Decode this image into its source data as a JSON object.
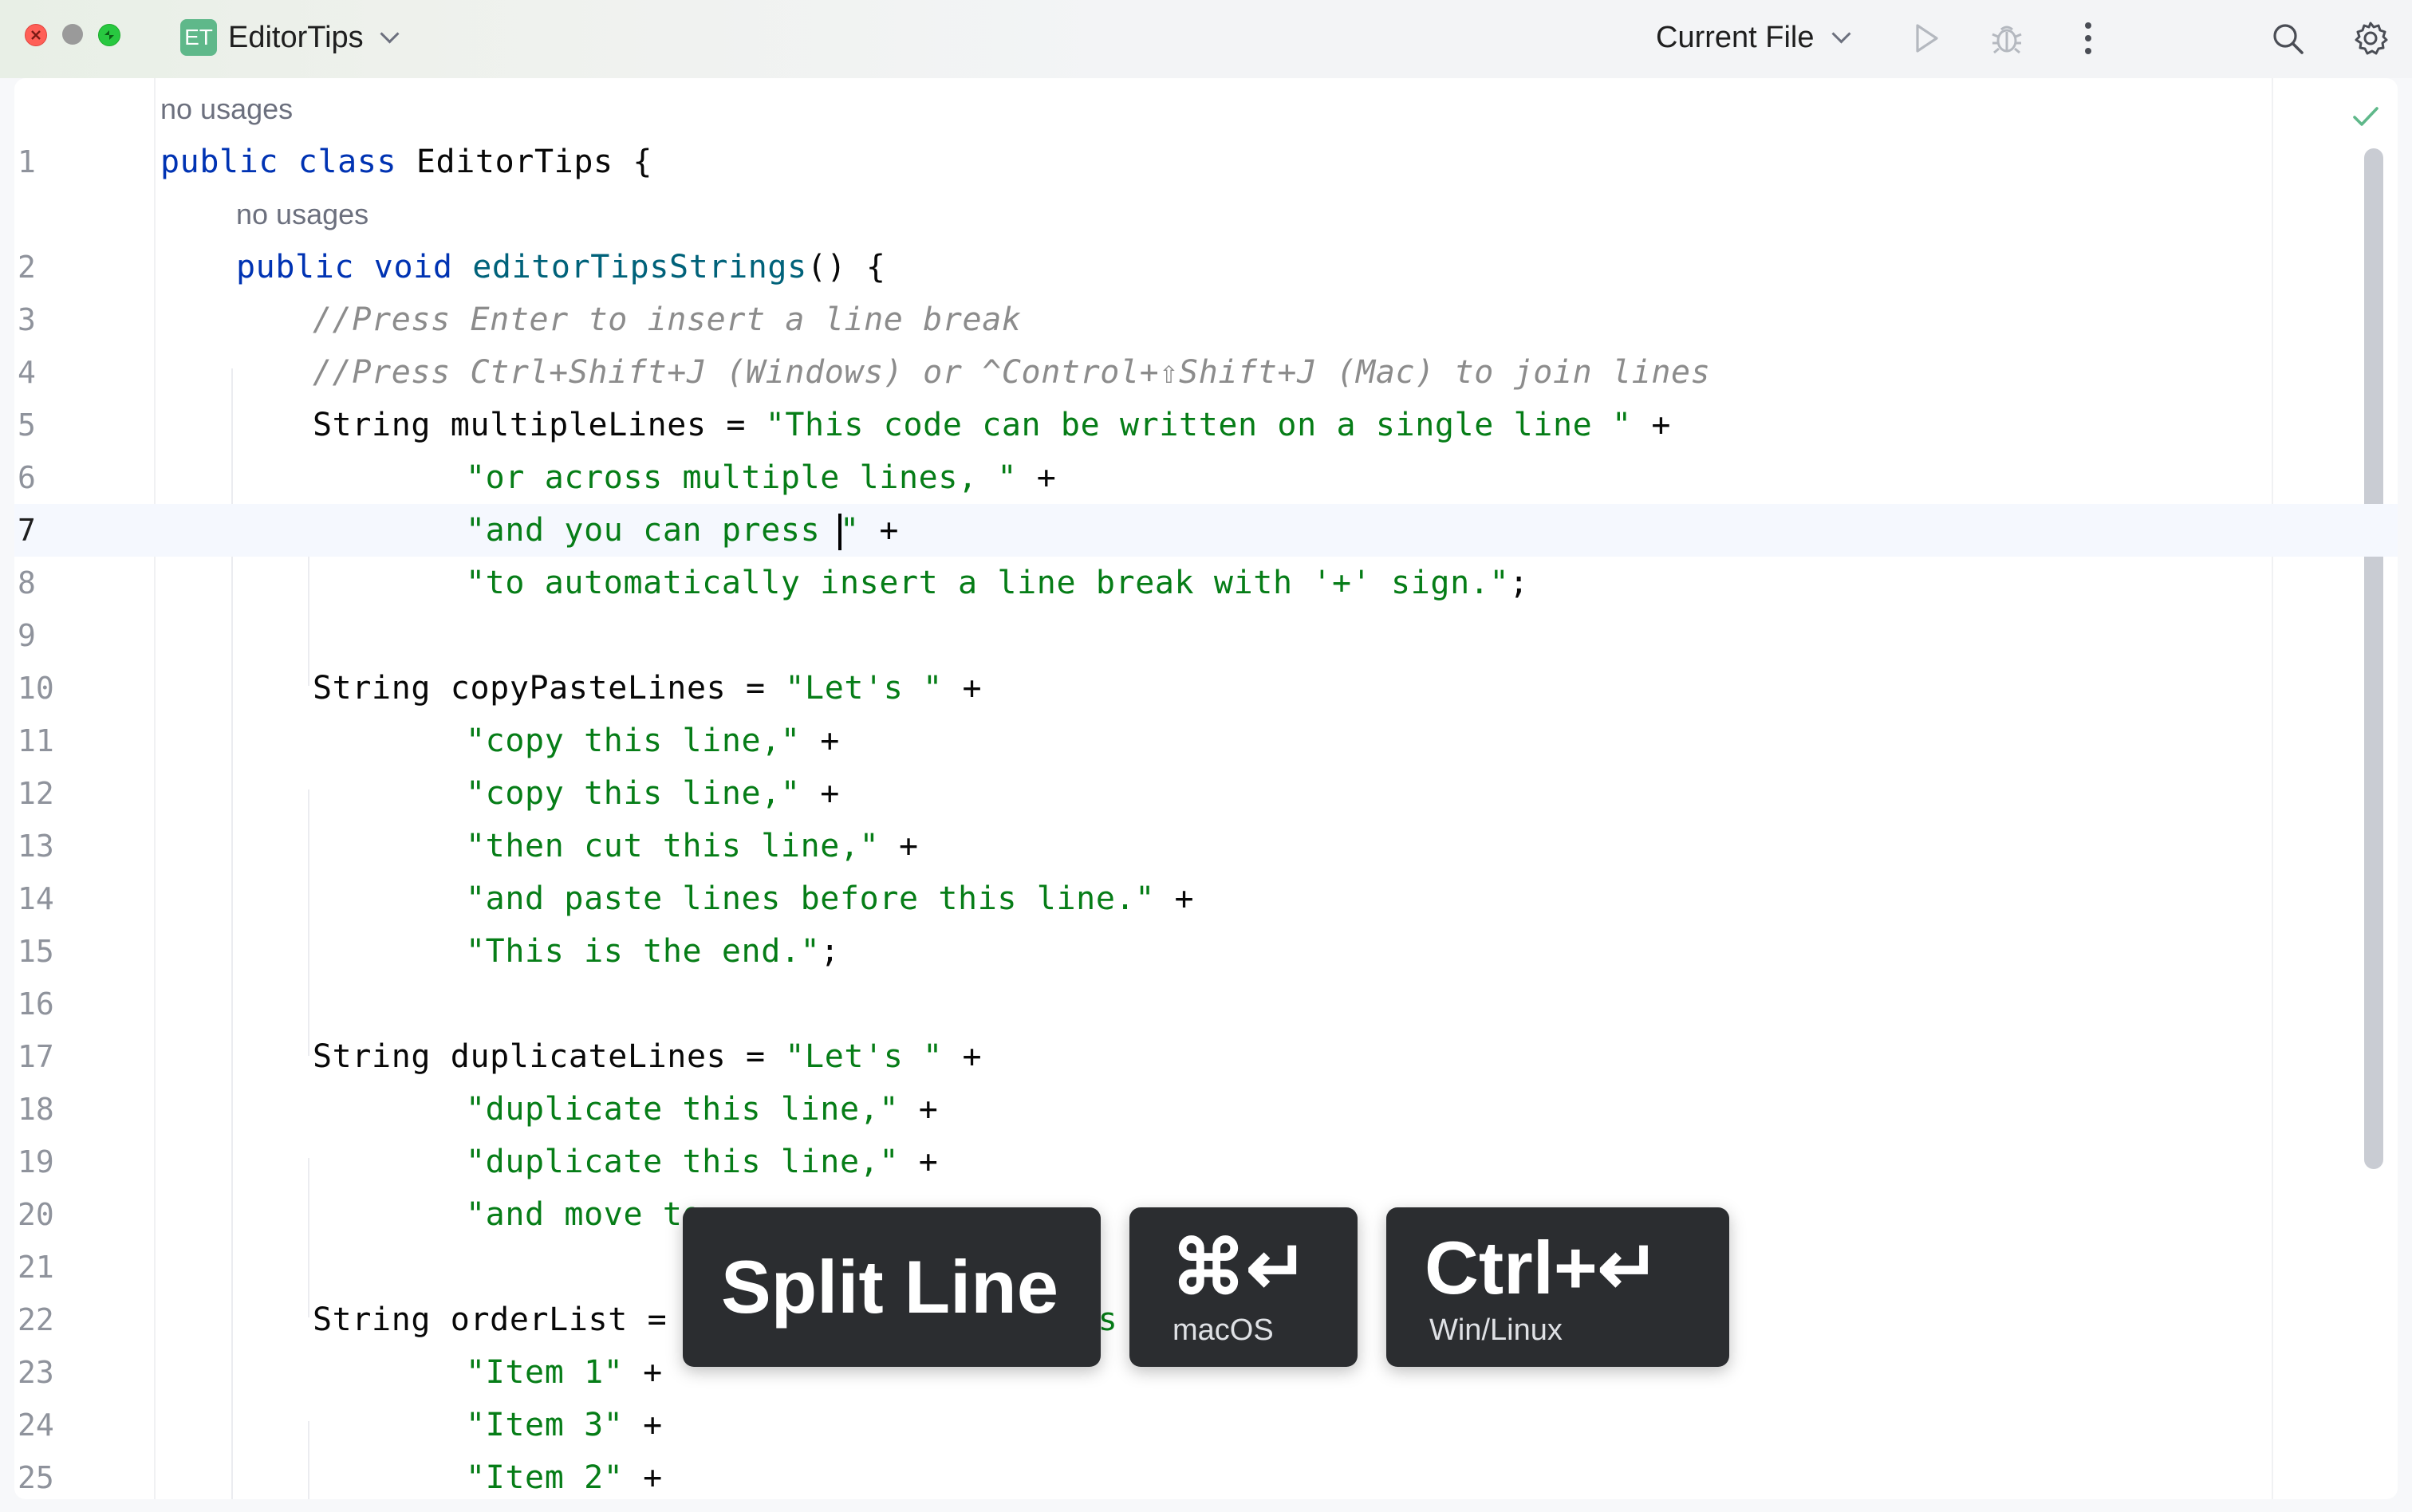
{
  "window": {
    "project_badge": "ET",
    "project_name": "EditorTips",
    "run_config": "Current File"
  },
  "editor": {
    "inlay_hint_class": "no usages",
    "inlay_hint_method": "no usages",
    "current_line": 7,
    "lines": [
      {
        "n": "1"
      },
      {
        "n": "2"
      },
      {
        "n": "3"
      },
      {
        "n": "4"
      },
      {
        "n": "5"
      },
      {
        "n": "6"
      },
      {
        "n": "7"
      },
      {
        "n": "8"
      },
      {
        "n": "9"
      },
      {
        "n": "10"
      },
      {
        "n": "11"
      },
      {
        "n": "12"
      },
      {
        "n": "13"
      },
      {
        "n": "14"
      },
      {
        "n": "15"
      },
      {
        "n": "16"
      },
      {
        "n": "17"
      },
      {
        "n": "18"
      },
      {
        "n": "19"
      },
      {
        "n": "20"
      },
      {
        "n": "21"
      },
      {
        "n": "22"
      },
      {
        "n": "23"
      },
      {
        "n": "24"
      },
      {
        "n": "25"
      }
    ],
    "code": {
      "l1_kw": "public class",
      "l1_rest": " EditorTips {",
      "l2_kw": "public void",
      "l2_fn": "editorTipsStrings",
      "l2_rest": "() {",
      "l3": "//Press Enter to insert a line break",
      "l4": "//Press Ctrl+Shift+J (Windows) or ^Control+⇧Shift+J (Mac) to join lines",
      "l5_a": "String multipleLines = ",
      "l5_s": "\"This code can be written on a single line \"",
      "l5_b": " +",
      "l6_s": "\"or across multiple lines, \"",
      "l6_b": " +",
      "l7_s1": "\"and you can press ",
      "l7_s2": "\"",
      "l7_b": " +",
      "l8_s": "\"to automatically insert a line break with '+' sign.\"",
      "l8_b": ";",
      "l10_a": "String copyPasteLines = ",
      "l10_s": "\"Let's \"",
      "l10_b": " +",
      "l11_s": "\"copy this line,\"",
      "l11_b": " +",
      "l12_s": "\"copy this line,\"",
      "l12_b": " +",
      "l13_s": "\"then cut this line,\"",
      "l13_b": " +",
      "l14_s": "\"and paste lines before this line.\"",
      "l14_b": " +",
      "l15_s": "\"This is the end.\"",
      "l15_b": ";",
      "l17_a": "String duplicateLines = ",
      "l17_s": "\"Let's \"",
      "l17_b": " +",
      "l18_s": "\"duplicate this line,\"",
      "l18_b": " +",
      "l19_s": "\"duplicate this line,\"",
      "l19_b": " +",
      "l20_s": "\"and move to",
      "l22_a": "String orderList = ",
      "l22_s": "\"",
      "l22_s2": "ms",
      "l23_s": "\"Item 1\"",
      "l23_b": " +",
      "l24_s": "\"Item 3\"",
      "l24_b": " +",
      "l25_s": "\"Item 2\"",
      "l25_b": " +"
    }
  },
  "shortcut_overlay": {
    "action": "Split Line",
    "mac_keys": "⌘↵",
    "mac_label": "macOS",
    "win_keys": "Ctrl+↵",
    "win_label": "Win/Linux"
  },
  "icons": [
    "close-icon",
    "minimize-icon",
    "maximize-icon",
    "chevron-down-icon",
    "run-icon",
    "debug-icon",
    "more-vertical-icon",
    "search-icon",
    "settings-gear-icon",
    "checkmark-icon"
  ],
  "colors": {
    "keyword": "#0033b3",
    "string": "#067d17",
    "comment": "#8c8c8c",
    "method": "#00627a",
    "overlay_bg": "#2b2d30"
  }
}
